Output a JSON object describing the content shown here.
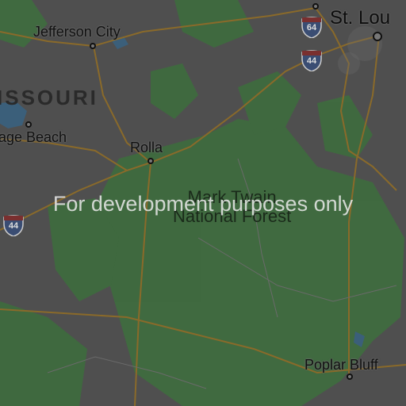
{
  "watermark": "For development purposes only",
  "state_label": "ISSOURI",
  "forest_label": {
    "line1": "Mark Twain",
    "line2": "National Forest"
  },
  "cities": {
    "jefferson_city": "Jefferson City",
    "st_louis": "St. Lou",
    "lake_ozark": "age Beach",
    "rolla": "Rolla",
    "poplar_bluff": "Poplar Bluff"
  },
  "interstates": {
    "i64": "64",
    "i44_north": "44",
    "i44_west": "44"
  },
  "colors": {
    "background": "#4f4f4f",
    "forest": "#3f6b3f",
    "road": "#8a6a2a",
    "water": "#3b5f7a"
  }
}
